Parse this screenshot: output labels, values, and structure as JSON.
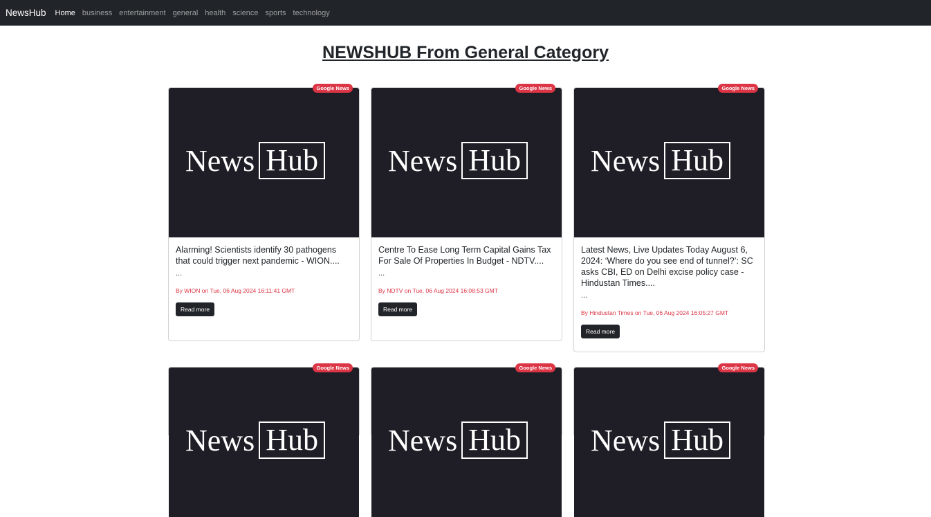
{
  "navbar": {
    "brand": "NewsHub",
    "links": [
      "Home",
      "business",
      "entertainment",
      "general",
      "health",
      "science",
      "sports",
      "technology"
    ]
  },
  "page_title": "NEWSHUB From General Category",
  "logo": {
    "news": "News",
    "hub": "Hub"
  },
  "cards": [
    {
      "badge": "Google News",
      "title": "Alarming! Scientists identify 30 pathogens that could trigger next pandemic - WION....",
      "desc": "...",
      "meta": "By WION on Tue, 06 Aug 2024 16:11:41 GMT",
      "button": "Read more"
    },
    {
      "badge": "Google News",
      "title": "Centre To Ease Long Term Capital Gains Tax For Sale Of Properties In Budget - NDTV....",
      "desc": "...",
      "meta": "By NDTV on Tue, 06 Aug 2024 16:08:53 GMT",
      "button": "Read more"
    },
    {
      "badge": "Google News",
      "title": "Latest News, Live Updates Today August 6, 2024: ‘Where do you see end of tunnel?’: SC asks CBI, ED on Delhi excise policy case - Hindustan Times....",
      "desc": "...",
      "meta": "By Hindustan Times on Tue, 06 Aug 2024 16:05:27 GMT",
      "button": "Read more"
    },
    {
      "badge": "Google News"
    },
    {
      "badge": "Google News"
    },
    {
      "badge": "Google News"
    }
  ],
  "colors": {
    "navbar_bg": "#212529",
    "badge_bg": "#dc3545",
    "meta_text": "#dc3545",
    "image_bg": "#1f1e26"
  }
}
